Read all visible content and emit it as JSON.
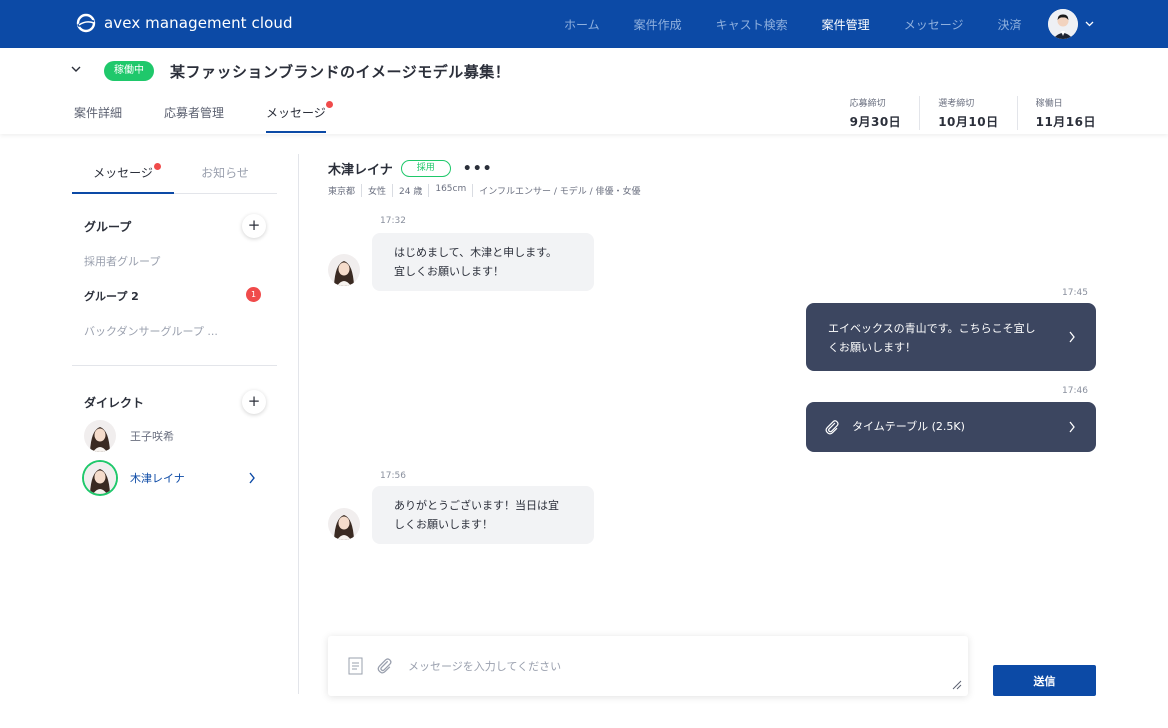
{
  "app": {
    "brand": "avex management cloud"
  },
  "nav": {
    "items": [
      {
        "label": "ホーム",
        "active": false
      },
      {
        "label": "案件作成",
        "active": false
      },
      {
        "label": "キャスト検索",
        "active": false
      },
      {
        "label": "案件管理",
        "active": true
      },
      {
        "label": "メッセージ",
        "active": false
      },
      {
        "label": "決済",
        "active": false
      }
    ]
  },
  "project": {
    "status": "稼働中",
    "title": "某ファッションブランドのイメージモデル募集！",
    "tabs": [
      {
        "label": "案件詳細",
        "active": false
      },
      {
        "label": "応募者管理",
        "active": false
      },
      {
        "label": "メッセージ",
        "active": true,
        "unread": true
      }
    ],
    "deadlines": [
      {
        "label": "応募締切",
        "value": "9月30日"
      },
      {
        "label": "選考締切",
        "value": "10月10日"
      },
      {
        "label": "稼働日",
        "value": "11月16日"
      }
    ]
  },
  "sidebar": {
    "tabs": [
      {
        "label": "メッセージ",
        "active": true,
        "unread": true
      },
      {
        "label": "お知らせ",
        "active": false
      }
    ],
    "groups_heading": "グループ",
    "groups": [
      {
        "label": "採用者グループ",
        "bold": false,
        "badge": ""
      },
      {
        "label": "グループ 2",
        "bold": true,
        "badge": "1"
      },
      {
        "label": "バックダンサーグループ ...",
        "bold": false,
        "badge": ""
      }
    ],
    "direct_heading": "ダイレクト",
    "direct": [
      {
        "name": "王子咲希",
        "selected": false
      },
      {
        "name": "木津レイナ",
        "selected": true
      }
    ]
  },
  "chat": {
    "name": "木津レイナ",
    "badge": "採用",
    "more": "•••",
    "meta": [
      "東京都",
      "女性",
      "24 歳",
      "165cm",
      "インフルエンサー / モデル / 俳優・女優"
    ],
    "messages": [
      {
        "time": "17:32",
        "lines": [
          "はじめまして、木津と申します。",
          "宜しくお願いします！"
        ]
      },
      {
        "time": "17:45",
        "lines": [
          "エイベックスの青山です。こちらこそ宜し",
          "くお願いします！"
        ]
      },
      {
        "time": "17:46",
        "text": "タイムテーブル (2.5K)"
      },
      {
        "time": "17:56",
        "lines": [
          "ありがとうございます！当日は宜",
          "しくお願いします！"
        ]
      }
    ]
  },
  "composer": {
    "placeholder": "メッセージを入力してください",
    "value": "",
    "send_label": "送信"
  },
  "colors": {
    "primary": "#0c4aa6",
    "success": "#1fc86b",
    "alert": "#f04b4b",
    "bubble_out": "#3c4660",
    "bubble_in": "#f2f3f5"
  }
}
